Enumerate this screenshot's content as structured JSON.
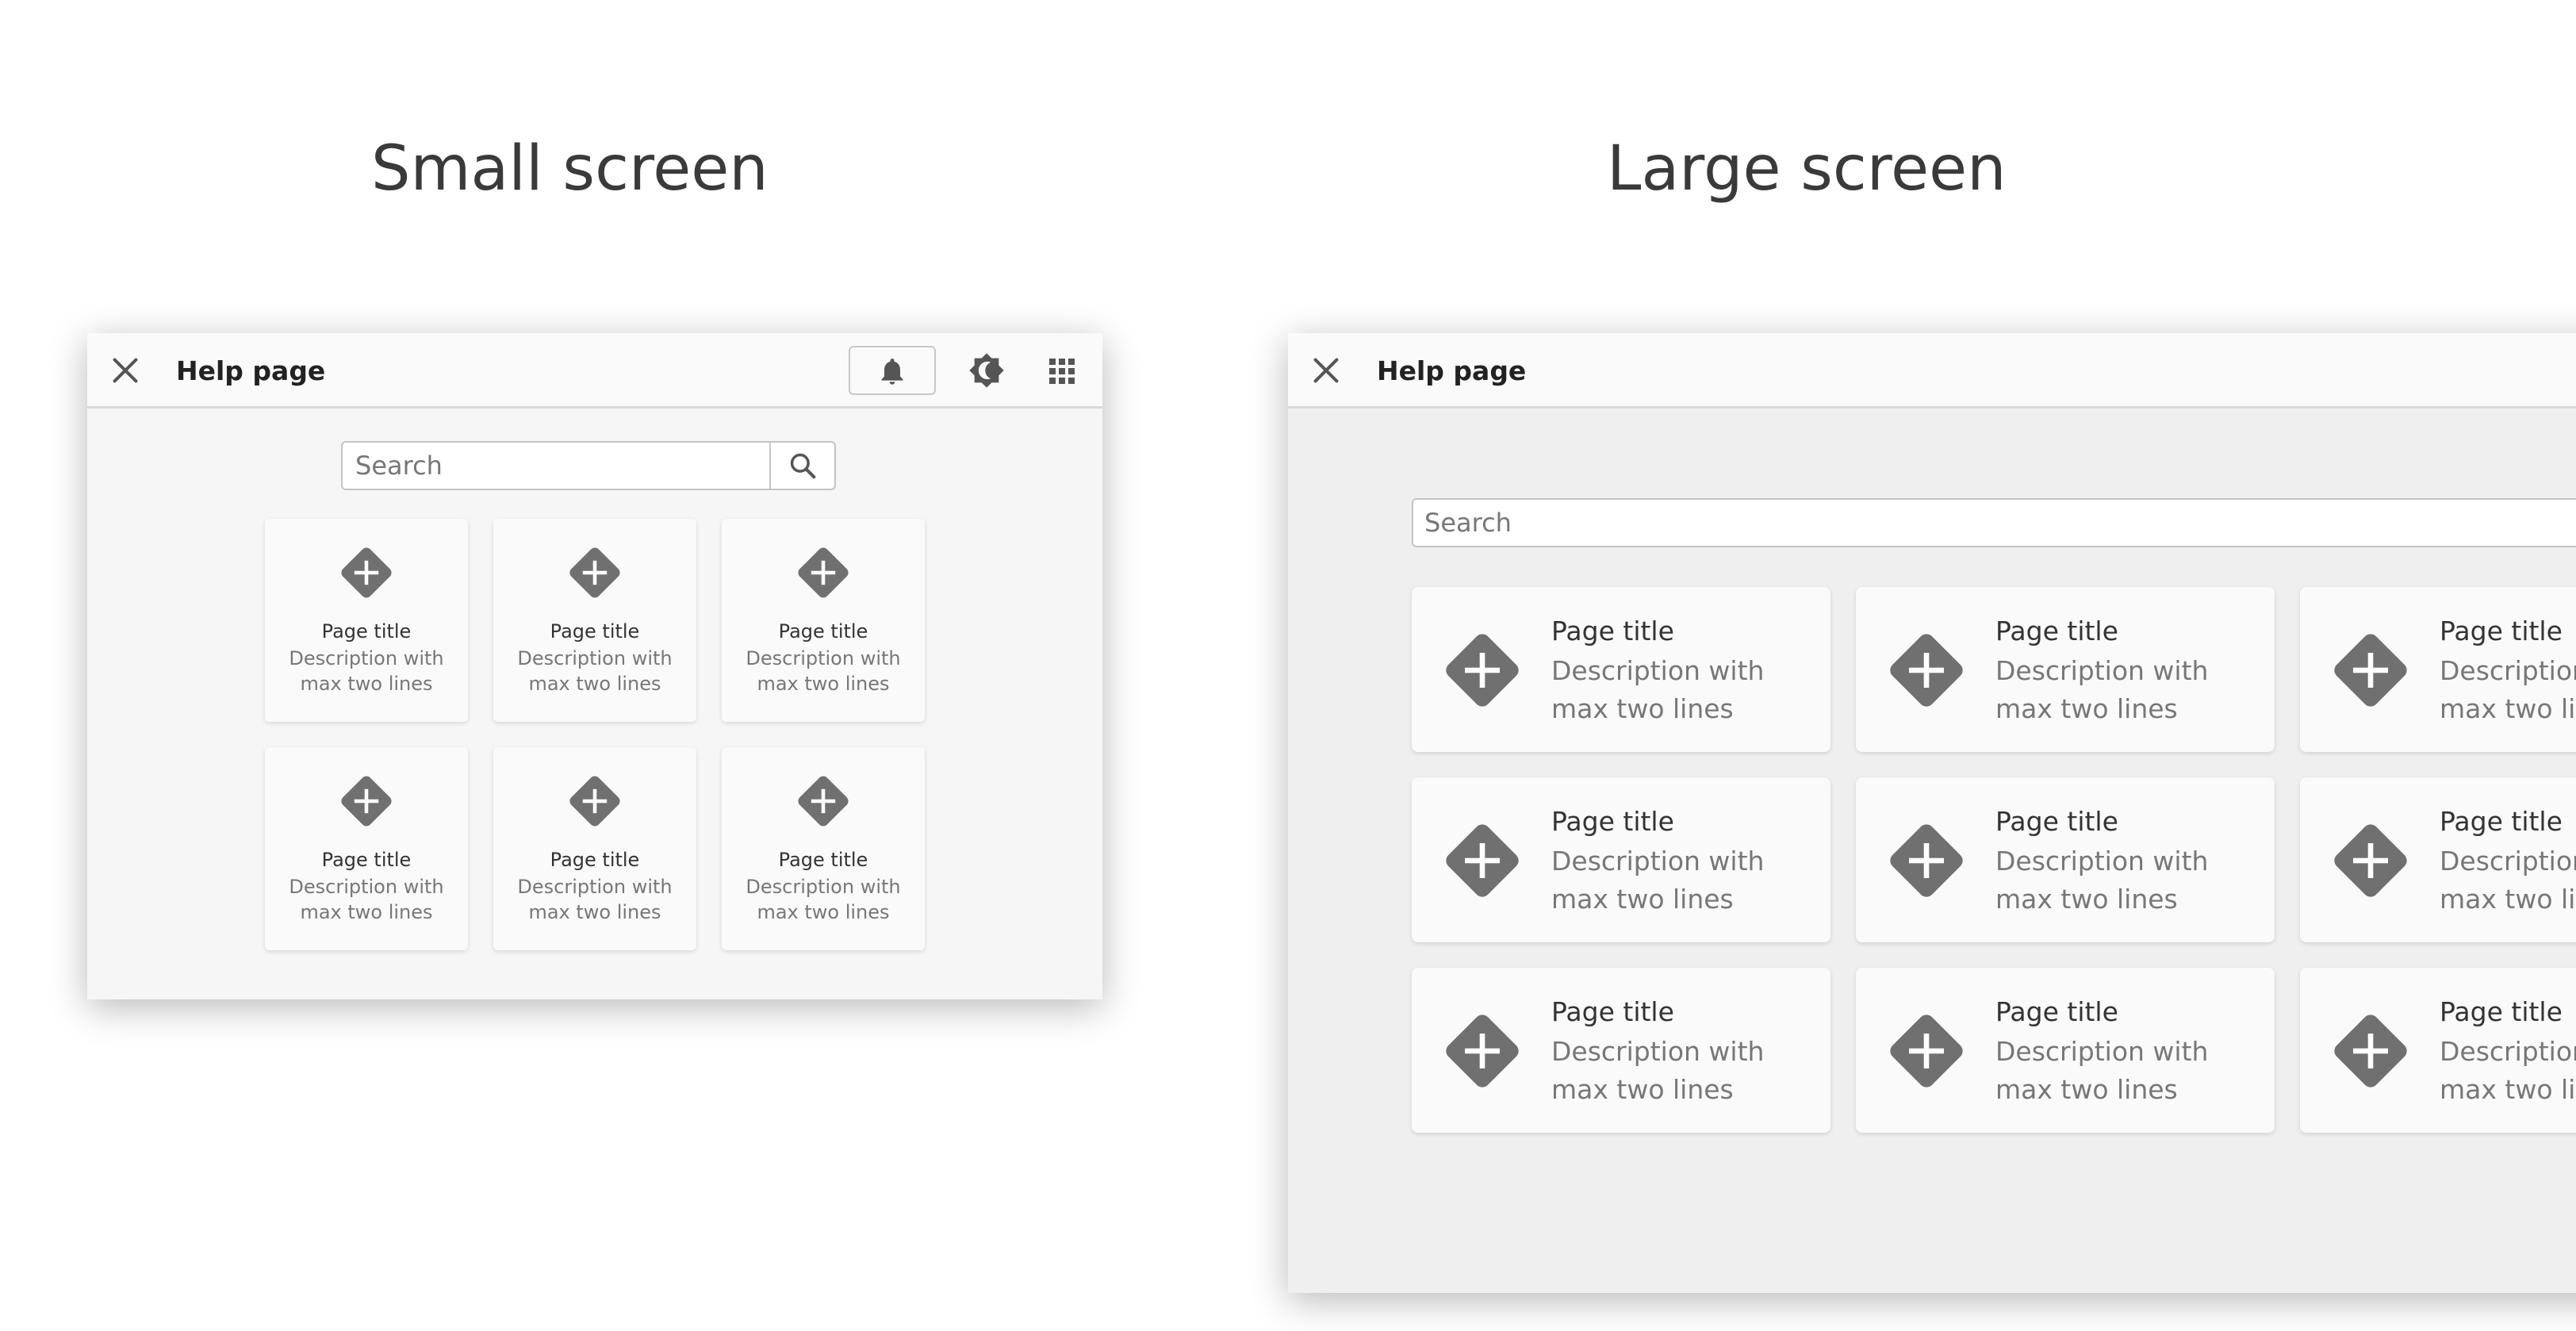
{
  "headings": {
    "small": "Small screen",
    "large": "Large screen"
  },
  "small_screen": {
    "title": "Help page",
    "search_placeholder": "Search",
    "cards": [
      {
        "title": "Page title",
        "description": "Description with max two lines"
      },
      {
        "title": "Page title",
        "description": "Description with max two lines"
      },
      {
        "title": "Page title",
        "description": "Description with max two lines"
      },
      {
        "title": "Page title",
        "description": "Description with max two lines"
      },
      {
        "title": "Page title",
        "description": "Description with max two lines"
      },
      {
        "title": "Page title",
        "description": "Description with max two lines"
      }
    ]
  },
  "large_screen": {
    "title": "Help page",
    "search_placeholder": "Search",
    "cards": [
      {
        "title": "Page title",
        "description": "Description with max two lines"
      },
      {
        "title": "Page title",
        "description": "Description with max two lines"
      },
      {
        "title": "Page title",
        "description": "Description with max two lines"
      },
      {
        "title": "Page title",
        "description": "Description with max two lines"
      },
      {
        "title": "Page title",
        "description": "Description with max two lines"
      },
      {
        "title": "Page title",
        "description": "Description with max two lines"
      },
      {
        "title": "Page title",
        "description": "Description with max two lines"
      },
      {
        "title": "Page title",
        "description": "Description with max two lines"
      },
      {
        "title": "Page title",
        "description": "Description with max two lines"
      }
    ]
  },
  "icons": {
    "close": "close-icon",
    "notifications": "bell-icon",
    "theme": "theme-toggle-icon",
    "apps": "grid-apps-icon",
    "search": "search-icon",
    "card": "diamond-plus-icon"
  },
  "colors": {
    "icon_gray": "#707070",
    "background_small": "#f6f6f6",
    "background_large": "#efefef",
    "card": "#fafafa"
  }
}
